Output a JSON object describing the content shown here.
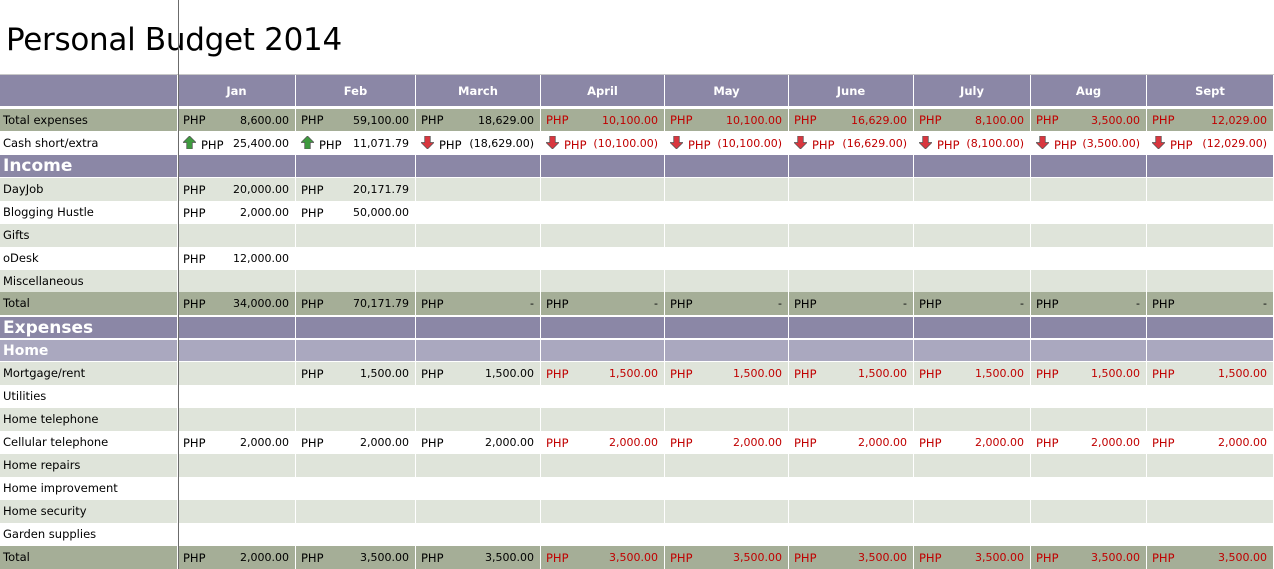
{
  "title": "Personal Budget 2014",
  "months": [
    "Jan",
    "Feb",
    "March",
    "April",
    "May",
    "June",
    "July",
    "Aug",
    "Sept"
  ],
  "currency": "PHP",
  "summary": {
    "total_expenses": {
      "label": "Total expenses",
      "values": [
        "8,600.00",
        "59,100.00",
        "18,629.00",
        "10,100.00",
        "10,100.00",
        "16,629.00",
        "8,100.00",
        "3,500.00",
        "12,029.00"
      ]
    },
    "cash": {
      "label": "Cash short/extra",
      "values": [
        "25,400.00",
        "11,071.79",
        "(18,629.00)",
        "(10,100.00)",
        "(10,100.00)",
        "(16,629.00)",
        "(8,100.00)",
        "(3,500.00)",
        "(12,029.00)"
      ],
      "arrows": [
        "up-arrow-icon",
        "up-arrow-icon",
        "down-arrow-icon",
        "down-arrow-icon",
        "down-arrow-icon",
        "down-arrow-icon",
        "down-arrow-icon",
        "down-arrow-icon",
        "down-arrow-icon"
      ]
    }
  },
  "income": {
    "header": "Income",
    "rows": [
      {
        "label": "DayJob",
        "values": [
          "20,000.00",
          "20,171.79",
          "",
          "",
          "",
          "",
          "",
          "",
          ""
        ]
      },
      {
        "label": "Blogging Hustle",
        "values": [
          "2,000.00",
          "50,000.00",
          "",
          "",
          "",
          "",
          "",
          "",
          ""
        ]
      },
      {
        "label": "Gifts",
        "values": [
          "",
          "",
          "",
          "",
          "",
          "",
          "",
          "",
          ""
        ]
      },
      {
        "label": "oDesk",
        "values": [
          "12,000.00",
          "",
          "",
          "",
          "",
          "",
          "",
          "",
          ""
        ]
      },
      {
        "label": "Miscellaneous",
        "values": [
          "",
          "",
          "",
          "",
          "",
          "",
          "",
          "",
          ""
        ]
      }
    ],
    "total": {
      "label": "Total",
      "values": [
        "34,000.00",
        "70,171.79",
        "-",
        "-",
        "-",
        "-",
        "-",
        "-",
        "-"
      ]
    }
  },
  "expenses": {
    "header": "Expenses",
    "home": {
      "header": "Home",
      "rows": [
        {
          "label": "Mortgage/rent",
          "values": [
            "",
            "1,500.00",
            "1,500.00",
            "1,500.00",
            "1,500.00",
            "1,500.00",
            "1,500.00",
            "1,500.00",
            "1,500.00"
          ]
        },
        {
          "label": "Utilities",
          "values": [
            "",
            "",
            "",
            "",
            "",
            "",
            "",
            "",
            ""
          ]
        },
        {
          "label": "Home telephone",
          "values": [
            "",
            "",
            "",
            "",
            "",
            "",
            "",
            "",
            ""
          ]
        },
        {
          "label": "Cellular telephone",
          "values": [
            "2,000.00",
            "2,000.00",
            "2,000.00",
            "2,000.00",
            "2,000.00",
            "2,000.00",
            "2,000.00",
            "2,000.00",
            "2,000.00"
          ]
        },
        {
          "label": "Home repairs",
          "values": [
            "",
            "",
            "",
            "",
            "",
            "",
            "",
            "",
            ""
          ]
        },
        {
          "label": "Home improvement",
          "values": [
            "",
            "",
            "",
            "",
            "",
            "",
            "",
            "",
            ""
          ]
        },
        {
          "label": "Home security",
          "values": [
            "",
            "",
            "",
            "",
            "",
            "",
            "",
            "",
            ""
          ]
        },
        {
          "label": "Garden supplies",
          "values": [
            "",
            "",
            "",
            "",
            "",
            "",
            "",
            "",
            ""
          ]
        }
      ],
      "total": {
        "label": "Total",
        "values": [
          "2,000.00",
          "3,500.00",
          "3,500.00",
          "3,500.00",
          "3,500.00",
          "3,500.00",
          "3,500.00",
          "3,500.00",
          "3,500.00"
        ]
      }
    }
  },
  "colors": {
    "header": "#8b87a6",
    "total": "#a5ae97",
    "band": "#dfe4da",
    "red_text": "#c00000",
    "up_arrow": "#3e9a3e",
    "down_arrow": "#d9363e"
  }
}
